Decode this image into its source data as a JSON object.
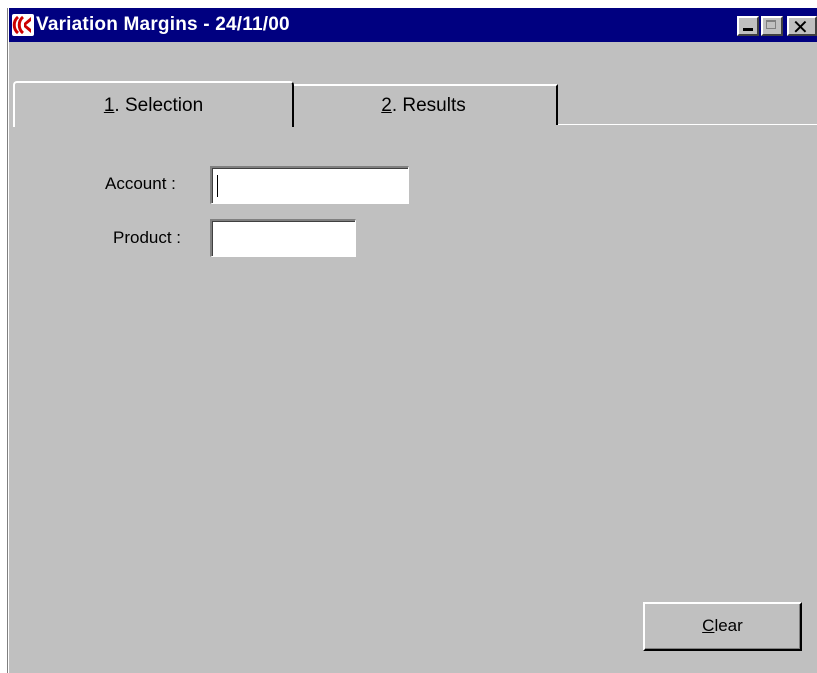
{
  "window": {
    "title": "Variation Margins - 24/11/00",
    "close_glyph": "✕"
  },
  "tabs": [
    {
      "key": "1",
      "rest": ". Selection"
    },
    {
      "key": "2",
      "rest": ". Results"
    }
  ],
  "form": {
    "account_label": "Account :",
    "account_value": "",
    "product_label": "Product :",
    "product_value": ""
  },
  "buttons": {
    "clear_key": "C",
    "clear_rest": "lear"
  },
  "colors": {
    "titlebar": "#000080",
    "face": "#c0c0c0",
    "icon_accent": "#cc0000"
  }
}
